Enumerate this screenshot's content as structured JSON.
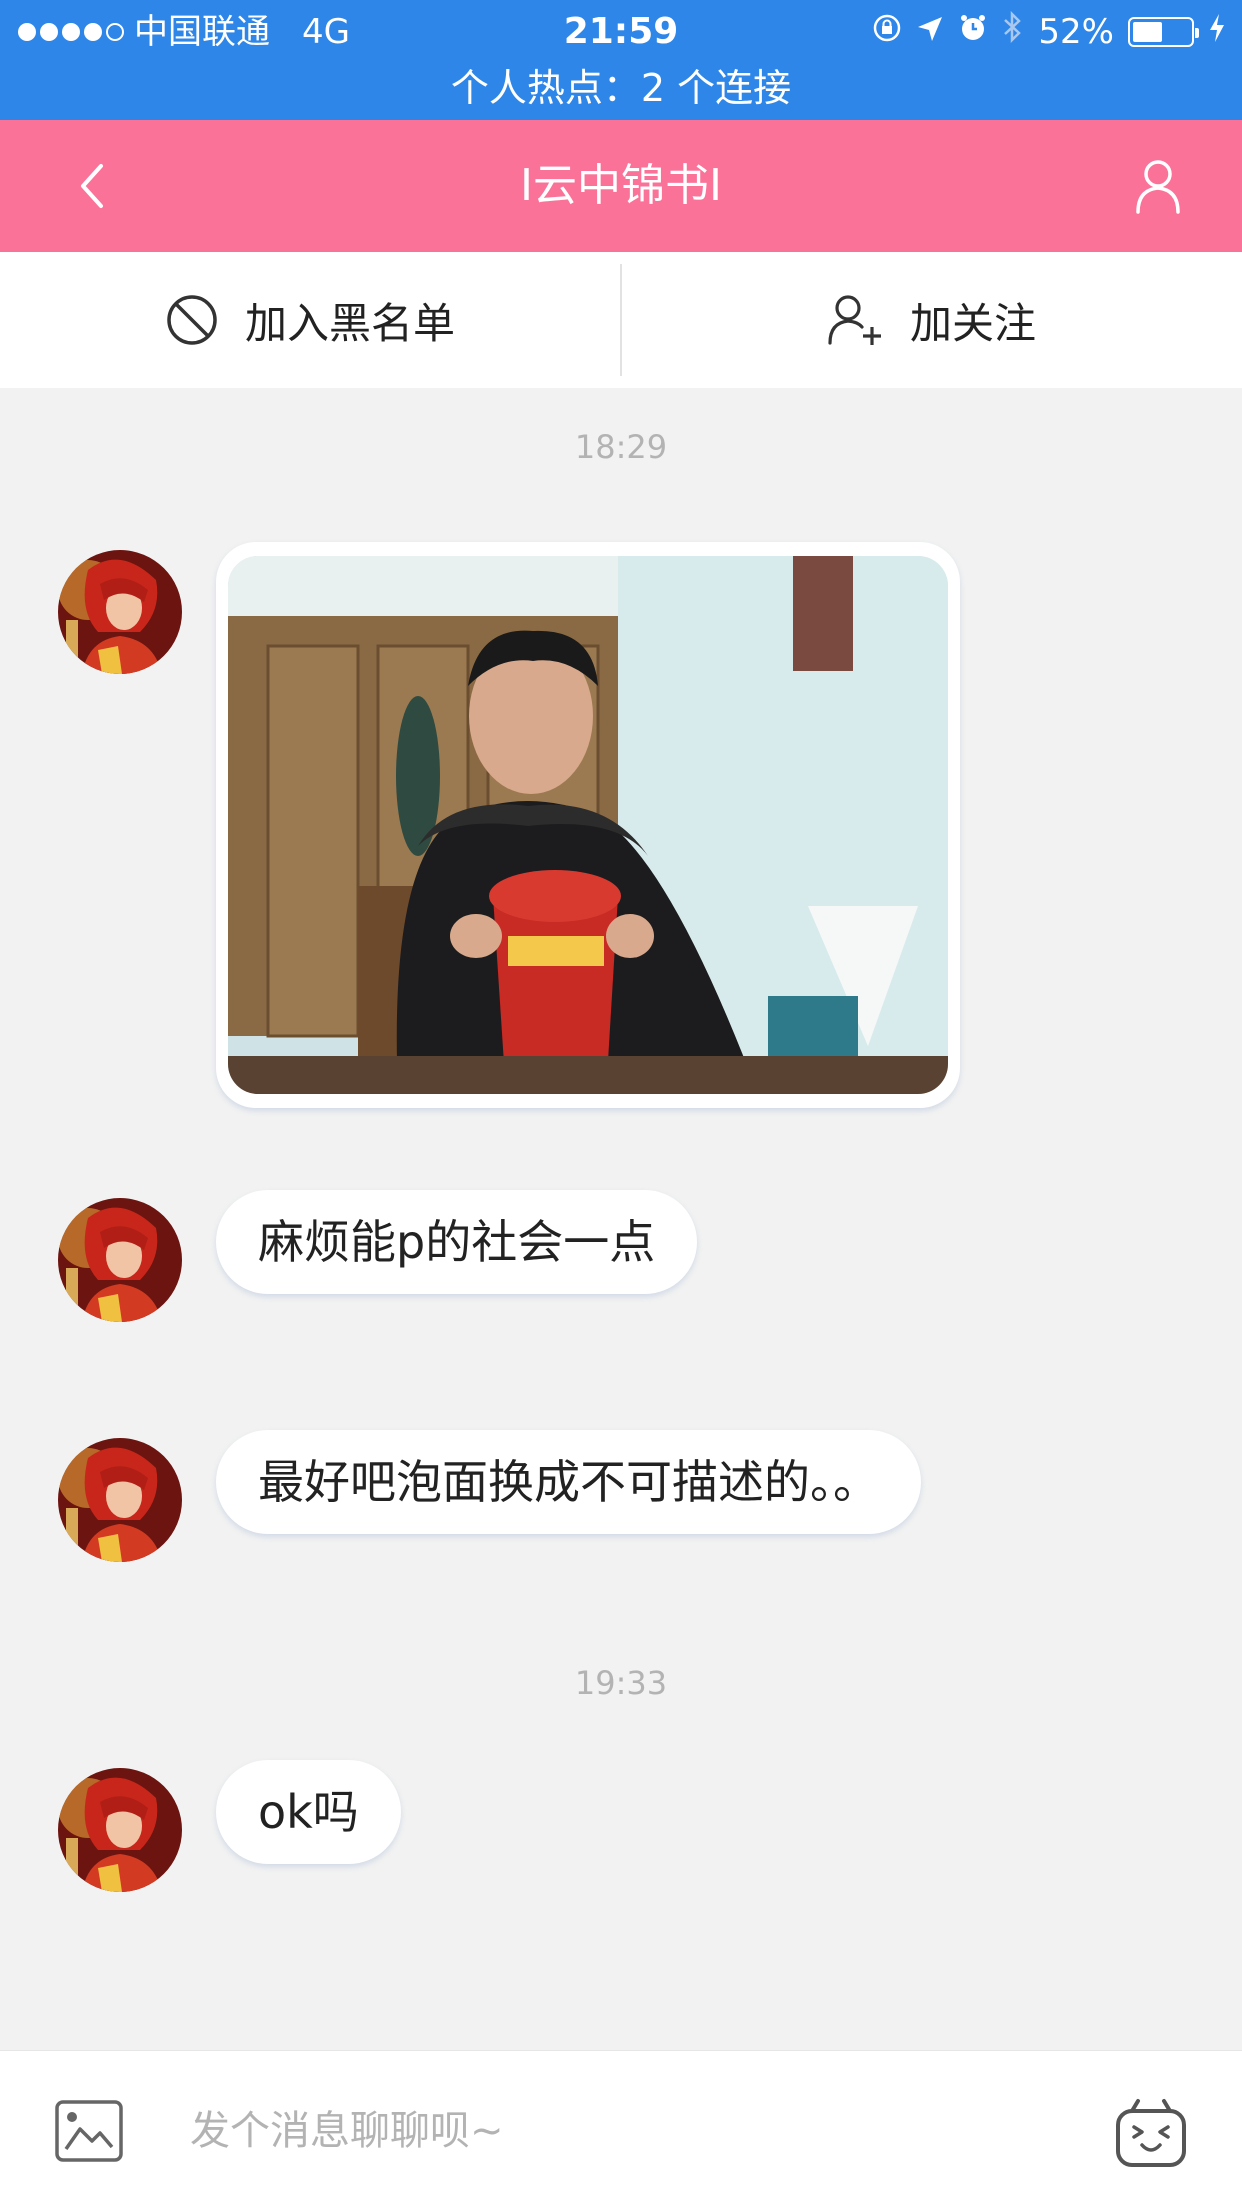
{
  "status_bar": {
    "carrier": "中国联通",
    "network": "4G",
    "time": "21:59",
    "battery_pct_label": "52%",
    "battery_level": 0.52,
    "hotspot_text": "个人热点：2 个连接",
    "bg_color": "#2d86e8"
  },
  "header": {
    "title": "I云中锦书I",
    "bg_color": "#fb7299",
    "back_icon": "chevron-left-icon",
    "profile_icon": "user-icon"
  },
  "actions": {
    "blacklist_label": "加入黑名单",
    "follow_label": "加关注"
  },
  "messages": {
    "time_1": "18:29",
    "image_caption": "",
    "msg_2": "麻烦能p的社会一点",
    "msg_3": "最好吧泡面换成不可描述的。。",
    "time_2": "19:33",
    "msg_4": "ok吗"
  },
  "input": {
    "placeholder": "发个消息聊聊呗~",
    "image_icon": "image-icon",
    "emoji_icon": "emoji-icon"
  }
}
